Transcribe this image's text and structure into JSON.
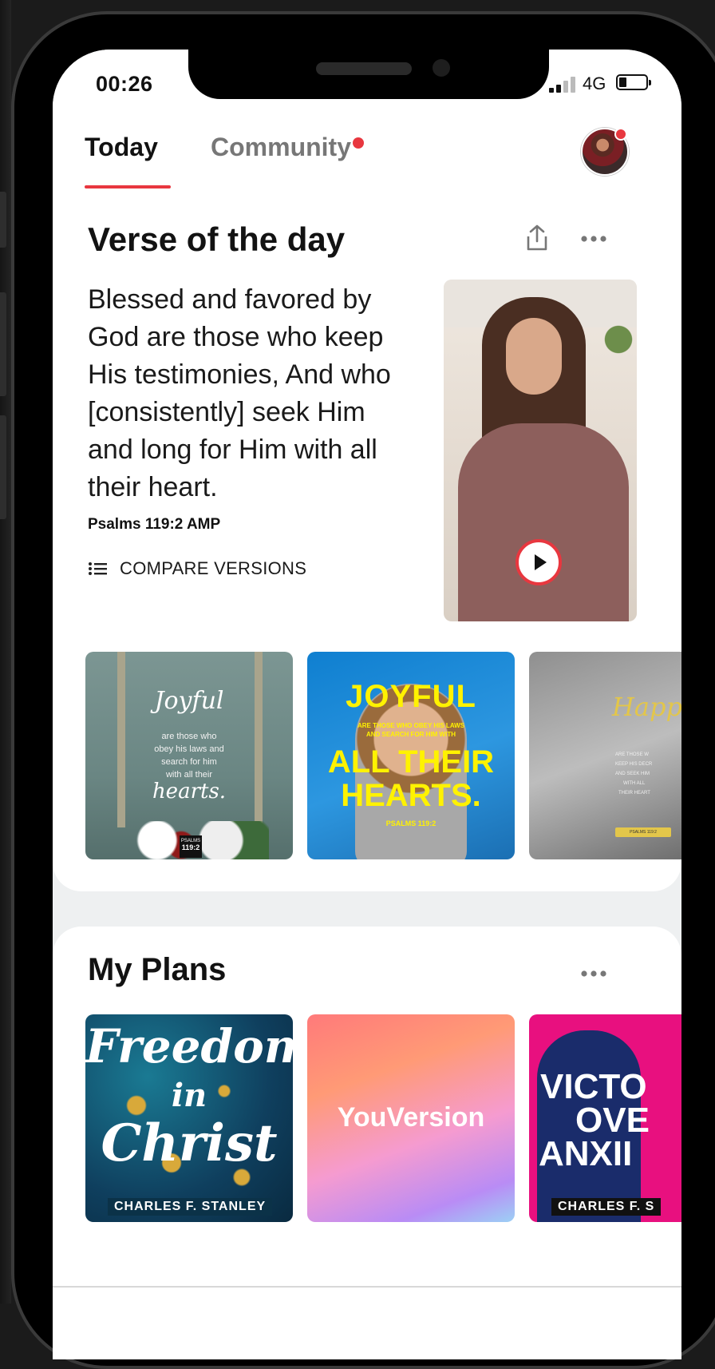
{
  "status_bar": {
    "time": "00:26",
    "network": "4G"
  },
  "tabs": [
    {
      "label": "Today",
      "active": true
    },
    {
      "label": "Community",
      "has_notification": true
    }
  ],
  "verse_of_the_day": {
    "title": "Verse of the day",
    "text": "Blessed and favored by God are those who keep His testimonies, And who [consistently] seek Him and long for Him with all their heart.",
    "reference": "Psalms 119:2 AMP",
    "compare_label": "COMPARE VERSIONS",
    "images": [
      {
        "title": "Joyful",
        "lines": [
          "are those who",
          "obey his laws and",
          "search for him",
          "with all their"
        ],
        "closing": "hearts.",
        "badge": [
          "PSALMS",
          "119:2"
        ]
      },
      {
        "title": "JOYFUL",
        "sub": [
          "ARE THOSE WHO OBEY HIS LAWS",
          "AND SEARCH FOR HIM WITH"
        ],
        "headline": [
          "ALL THEIR",
          "HEARTS."
        ],
        "reference": "PSALMS 119:2"
      },
      {
        "title": "Happ",
        "lines": [
          "ARE THOSE W",
          "KEEP HIS DECR",
          "AND SEEK HIM",
          "WITH ALL",
          "THEIR HEART"
        ],
        "badge": "PSALMS 119:2"
      }
    ]
  },
  "my_plans": {
    "title": "My Plans",
    "plans": [
      {
        "title_lines": [
          "Freedom",
          "in",
          "Christ"
        ],
        "author": "CHARLES F. STANLEY"
      },
      {
        "brand": "YouVersion"
      },
      {
        "title_lines": [
          "VICTO",
          "OVE",
          "ANXII"
        ],
        "author": "CHARLES F. S"
      }
    ]
  },
  "colors": {
    "accent": "#e8373f",
    "text": "#121212",
    "muted": "#777777"
  }
}
